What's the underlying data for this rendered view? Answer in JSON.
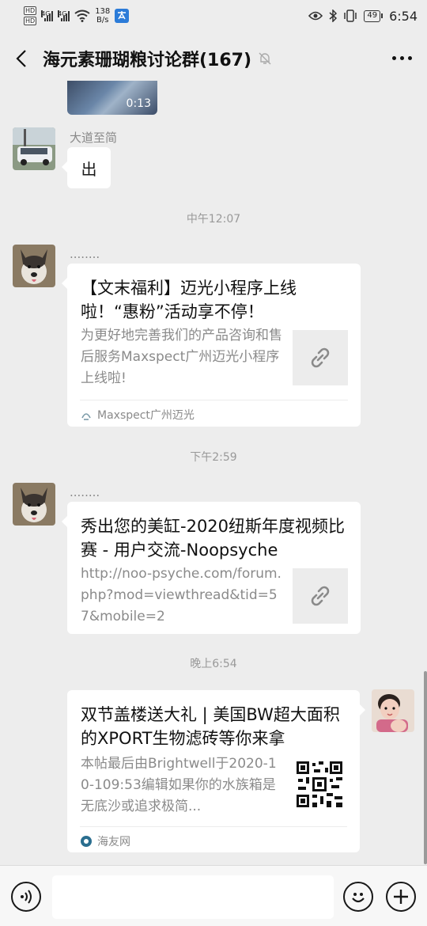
{
  "status_bar": {
    "hd1": "HD",
    "hd2": "HD",
    "sim1": "4G",
    "sim2": "4G",
    "net_speed_value": "138",
    "net_speed_unit": "B/s",
    "battery": "49",
    "time": "6:54"
  },
  "header": {
    "title": "海元素珊瑚粮讨论群(167)"
  },
  "messages": {
    "video_duration": "0:13",
    "msg1": {
      "sender": "大道至简",
      "text": "出"
    },
    "time1": "中午12:07",
    "msg2": {
      "sender": "........",
      "title": "【文末福利】迈光小程序上线啦！“惠粉”活动享不停！",
      "desc": "为更好地完善我们的产品咨询和售后服务Maxspect广州迈光小程序上线啦!",
      "source": "Maxspect广州迈光"
    },
    "time2": "下午2:59",
    "msg3": {
      "sender": "........",
      "title": "秀出您的美缸-2020纽斯年度视频比赛 - 用户交流-Noopsyche",
      "desc": "http://noo-psyche.com/forum.php?mod=viewthread&tid=57&mobile=2"
    },
    "time3": "晚上6:54",
    "msg4": {
      "title": "双节盖楼送大礼 | 美国BW超大面积的XPORT生物滤砖等你来拿",
      "desc": "本帖最后由Brightwell于2020-10-109:53编辑如果你的水族箱是无底沙或追求极简...",
      "source": "海友网"
    }
  },
  "colors": {
    "background": "#ededed",
    "bubble": "#ffffff",
    "meta_text": "#999999"
  }
}
